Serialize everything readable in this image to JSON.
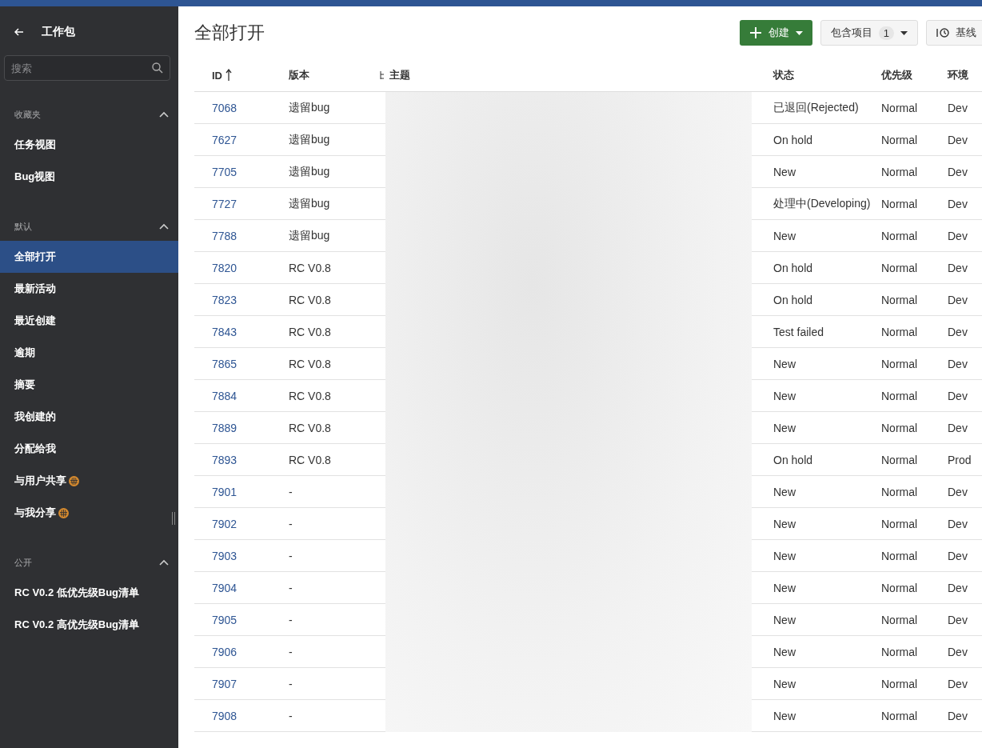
{
  "sidebar": {
    "title": "工作包",
    "search": {
      "placeholder": "搜索"
    },
    "sections": [
      {
        "title": "收藏夹",
        "expanded": true,
        "items": [
          {
            "label": "任务视图",
            "selected": false,
            "shared": false
          },
          {
            "label": "Bug视图",
            "selected": false,
            "shared": false
          }
        ]
      },
      {
        "title": "默认",
        "expanded": true,
        "items": [
          {
            "label": "全部打开",
            "selected": true,
            "shared": false
          },
          {
            "label": "最新活动",
            "selected": false,
            "shared": false
          },
          {
            "label": "最近创建",
            "selected": false,
            "shared": false
          },
          {
            "label": "逾期",
            "selected": false,
            "shared": false
          },
          {
            "label": "摘要",
            "selected": false,
            "shared": false
          },
          {
            "label": "我创建的",
            "selected": false,
            "shared": false
          },
          {
            "label": "分配给我",
            "selected": false,
            "shared": false
          },
          {
            "label": "与用户共享",
            "selected": false,
            "shared": true
          },
          {
            "label": "与我分享",
            "selected": false,
            "shared": true
          }
        ]
      },
      {
        "title": "公开",
        "expanded": true,
        "items": [
          {
            "label": "RC V0.2 低优先级Bug清单",
            "selected": false,
            "shared": false
          },
          {
            "label": "RC V0.2 高优先级Bug清单",
            "selected": false,
            "shared": false
          }
        ]
      }
    ]
  },
  "header": {
    "title": "全部打开",
    "create_button": "创建",
    "include_button": {
      "label": "包含项目",
      "count": "1"
    },
    "baseline_button": "基线"
  },
  "table": {
    "columns": [
      {
        "label": "ID",
        "sorted": true
      },
      {
        "label": "版本",
        "sorted": false
      },
      {
        "label": "主题",
        "sorted": false
      },
      {
        "label": "状态",
        "sorted": false
      },
      {
        "label": "优先级",
        "sorted": false
      },
      {
        "label": "环境",
        "sorted": false
      }
    ],
    "rows": [
      {
        "id": "7068",
        "version": "遗留bug",
        "status": "已退回(Rejected)",
        "priority": "Normal",
        "environment": "Dev"
      },
      {
        "id": "7627",
        "version": "遗留bug",
        "status": "On hold",
        "priority": "Normal",
        "environment": "Dev"
      },
      {
        "id": "7705",
        "version": "遗留bug",
        "status": "New",
        "priority": "Normal",
        "environment": "Dev"
      },
      {
        "id": "7727",
        "version": "遗留bug",
        "status": "处理中(Developing)",
        "priority": "Normal",
        "environment": "Dev"
      },
      {
        "id": "7788",
        "version": "遗留bug",
        "status": "New",
        "priority": "Normal",
        "environment": "Dev"
      },
      {
        "id": "7820",
        "version": "RC V0.8",
        "status": "On hold",
        "priority": "Normal",
        "environment": "Dev"
      },
      {
        "id": "7823",
        "version": "RC V0.8",
        "status": "On hold",
        "priority": "Normal",
        "environment": "Dev"
      },
      {
        "id": "7843",
        "version": "RC V0.8",
        "status": "Test failed",
        "priority": "Normal",
        "environment": "Dev"
      },
      {
        "id": "7865",
        "version": "RC V0.8",
        "status": "New",
        "priority": "Normal",
        "environment": "Dev"
      },
      {
        "id": "7884",
        "version": "RC V0.8",
        "status": "New",
        "priority": "Normal",
        "environment": "Dev"
      },
      {
        "id": "7889",
        "version": "RC V0.8",
        "status": "New",
        "priority": "Normal",
        "environment": "Dev"
      },
      {
        "id": "7893",
        "version": "RC V0.8",
        "status": "On hold",
        "priority": "Normal",
        "environment": "Prod"
      },
      {
        "id": "7901",
        "version": "-",
        "status": "New",
        "priority": "Normal",
        "environment": "Dev"
      },
      {
        "id": "7902",
        "version": "-",
        "status": "New",
        "priority": "Normal",
        "environment": "Dev"
      },
      {
        "id": "7903",
        "version": "-",
        "status": "New",
        "priority": "Normal",
        "environment": "Dev"
      },
      {
        "id": "7904",
        "version": "-",
        "status": "New",
        "priority": "Normal",
        "environment": "Dev"
      },
      {
        "id": "7905",
        "version": "-",
        "status": "New",
        "priority": "Normal",
        "environment": "Dev"
      },
      {
        "id": "7906",
        "version": "-",
        "status": "New",
        "priority": "Normal",
        "environment": "Dev"
      },
      {
        "id": "7907",
        "version": "-",
        "status": "New",
        "priority": "Normal",
        "environment": "Dev"
      },
      {
        "id": "7908",
        "version": "-",
        "status": "New",
        "priority": "Normal",
        "environment": "Dev"
      }
    ]
  }
}
